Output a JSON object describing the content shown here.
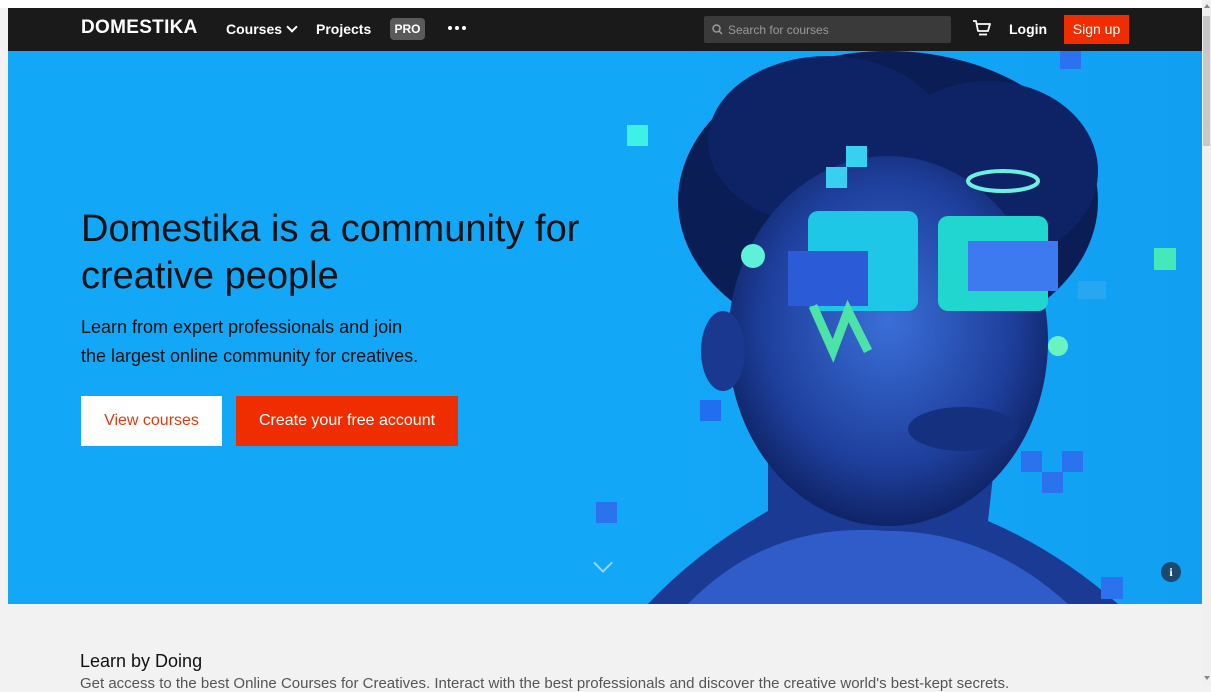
{
  "navbar": {
    "logo": "DOMESTIKA",
    "courses_label": "Courses",
    "projects_label": "Projects",
    "pro_label": "PRO",
    "search_placeholder": "Search for courses",
    "login_label": "Login",
    "signup_label": "Sign up"
  },
  "hero": {
    "title": "Domestika is a community for creative people",
    "subtitle_line1": "Learn from expert professionals and join",
    "subtitle_line2": "the largest online community for creatives.",
    "view_courses_label": "View courses",
    "create_account_label": "Create your free account",
    "info_label": "i"
  },
  "learn": {
    "title": "Learn by Doing",
    "description": "Get access to the best Online Courses for Creatives. Interact with the best professionals and discover the creative world's best-kept secrets."
  },
  "colors": {
    "navbar_bg": "#1a1a1a",
    "hero_bg": "#13a7f7",
    "accent_red": "#f02d00"
  },
  "icons": [
    "search-icon",
    "cart-icon",
    "chevron-down-icon",
    "more-icon",
    "info-icon"
  ]
}
